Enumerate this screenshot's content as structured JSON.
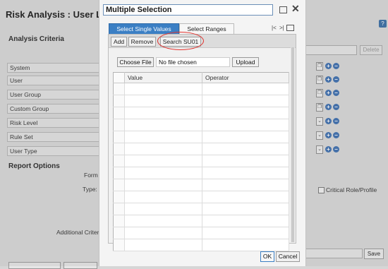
{
  "background": {
    "title": "Risk Analysis : User L",
    "help_icon": "?",
    "analysis_criteria_title": "Analysis Criteria",
    "criteria_rows": [
      "System",
      "User",
      "User Group",
      "Custom Group",
      "Risk Level",
      "Rule Set",
      "User Type"
    ],
    "delete_label": "Delete",
    "report_options_title": "Report Options",
    "form_label": "Form",
    "type_label": "Type:",
    "additional_criteria_label": "Additional Criteri",
    "critical_label": "Critical Role/Profile",
    "save_label": "Save"
  },
  "dialog": {
    "title": "Multiple Selection",
    "tabs": [
      "Select Single Values",
      "Select Ranges"
    ],
    "toolbar": {
      "add": "Add",
      "remove": "Remove",
      "search": "Search SU01"
    },
    "choose_file": "Choose File",
    "file_status": "No file chosen",
    "upload": "Upload",
    "columns": [
      "Value",
      "Operator"
    ],
    "ok": "OK",
    "cancel": "Cancel"
  },
  "colors": {
    "active_tab": "#3b7fc4",
    "highlight_circle": "#e2322d"
  }
}
